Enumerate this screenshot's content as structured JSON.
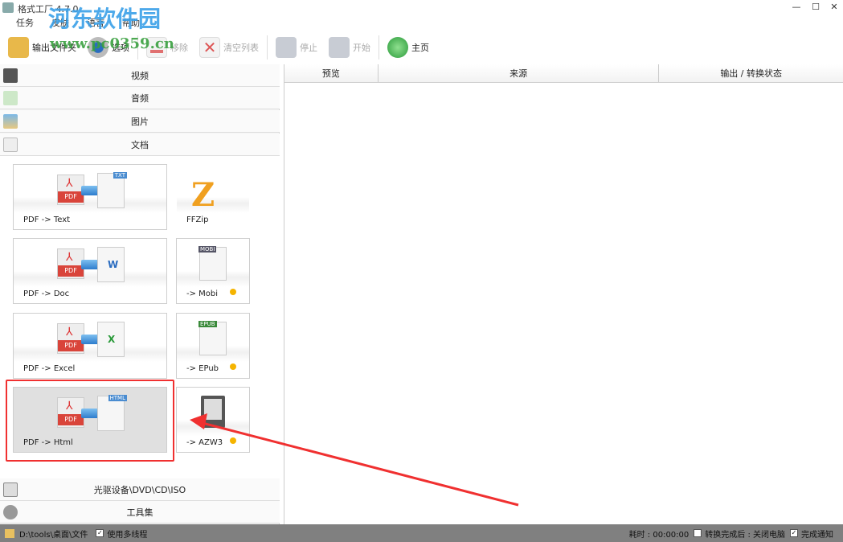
{
  "window": {
    "title": "格式工厂 4.7.0",
    "minimize": "—",
    "maximize": "☐",
    "close": "✕"
  },
  "menu": [
    "任务",
    "皮肤",
    "语言",
    "帮助"
  ],
  "toolbar": {
    "output_folder": "输出文件夹",
    "options": "选项",
    "remove": "移除",
    "clear_list": "清空列表",
    "stop": "停止",
    "start": "开始",
    "home": "主页"
  },
  "categories": {
    "video": "视频",
    "audio": "音频",
    "image": "图片",
    "document": "文档",
    "optical": "光驱设备\\DVD\\CD\\ISO",
    "tools": "工具集"
  },
  "tiles": [
    {
      "label": "PDF -> Text",
      "badge": "TXT"
    },
    {
      "label": "FFZip"
    },
    {
      "label": "PDF -> Doc",
      "badge": "W"
    },
    {
      "label": "-> Mobi",
      "badge": "MOBI"
    },
    {
      "label": "PDF -> Excel",
      "badge": "X"
    },
    {
      "label": "-> EPub",
      "badge": "EPUB"
    },
    {
      "label": "PDF -> Html",
      "badge": "HTML"
    },
    {
      "label": "-> AZW3"
    }
  ],
  "table": {
    "columns": [
      "预览",
      "来源",
      "输出 / 转换状态"
    ]
  },
  "status": {
    "path": "D:\\tools\\桌面\\文件",
    "multithread": "使用多线程",
    "multithread_checked": true,
    "elapsed": "耗时 : 00:00:00",
    "after_convert": "转换完成后 : 关闭电脑",
    "after_convert_checked": false,
    "notify": "完成通知",
    "notify_checked": true
  },
  "watermark": {
    "name": "河东软件园",
    "url": "www.pc0359.cn"
  },
  "colors": {
    "highlight": "#f03030",
    "status_bar": "#808080",
    "dot": "#f5b400"
  }
}
